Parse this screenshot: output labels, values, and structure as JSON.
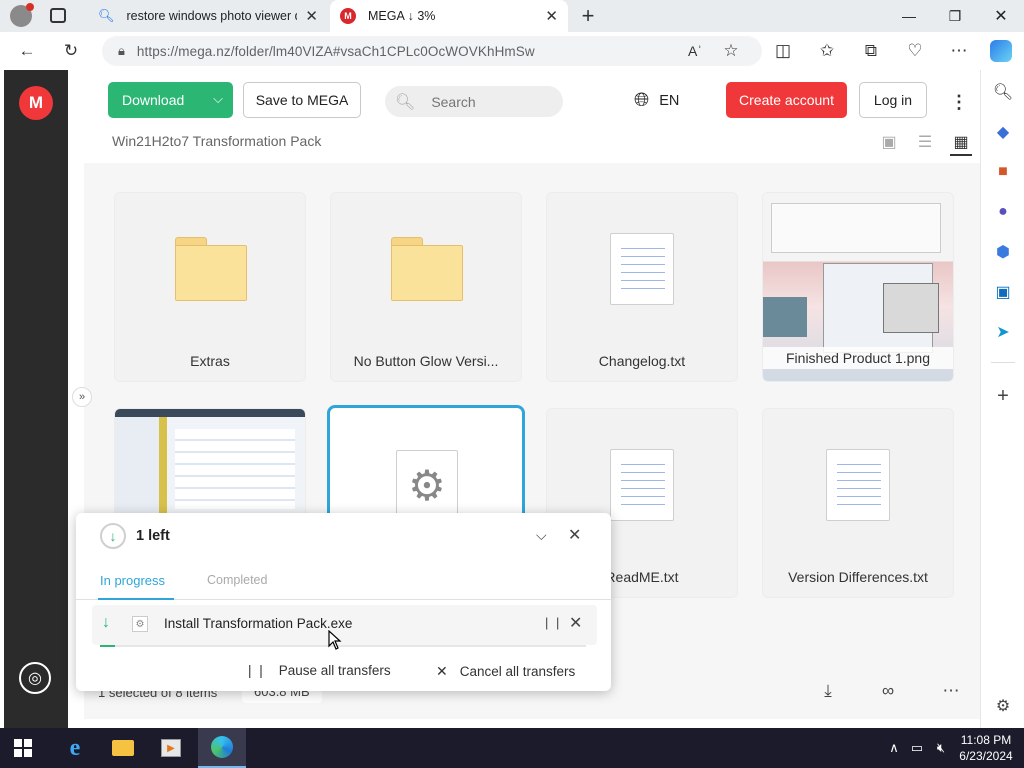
{
  "browser": {
    "tabs": [
      {
        "title": "restore windows photo viewer de",
        "icon": "search-icon"
      },
      {
        "title": "MEGA ↓ 3%",
        "icon": "mega-logo-icon"
      }
    ],
    "url": "https://mega.nz/folder/lm40VIZA#vsaCh1CPLc0OcWOVKhHmSw"
  },
  "mega": {
    "logo": "M",
    "toolbar": {
      "download_label": "Download",
      "save_label": "Save to MEGA",
      "search_placeholder": "Search",
      "language": "EN",
      "create_account_label": "Create account",
      "login_label": "Log in"
    },
    "folder_title": "Win21H2to7 Transformation Pack",
    "items": [
      {
        "name": "Extras",
        "type": "folder"
      },
      {
        "name": "No Button Glow Versi...",
        "type": "folder"
      },
      {
        "name": "Changelog.txt",
        "type": "text"
      },
      {
        "name": "Finished Product 1.png",
        "type": "image"
      },
      {
        "name": "",
        "type": "image"
      },
      {
        "name": "",
        "type": "exe"
      },
      {
        "name": "ReadME.txt",
        "type": "text"
      },
      {
        "name": "Version Differences.txt",
        "type": "text"
      }
    ],
    "status": {
      "selection": "1 selected of 8 items",
      "size": "603.8 MB"
    }
  },
  "transfers": {
    "header": "1 left",
    "tab_in_progress": "In progress",
    "tab_completed": "Completed",
    "file_name": "Install Transformation Pack.exe",
    "progress_fraction": 0.03,
    "pause_all_label": "Pause all transfers",
    "cancel_all_label": "Cancel all transfers"
  },
  "taskbar": {
    "time": "11:08 PM",
    "date": "6/23/2024"
  },
  "colors": {
    "mega_red": "#f0373a",
    "download_green": "#2bb673",
    "accent_blue": "#2fa5d9"
  }
}
